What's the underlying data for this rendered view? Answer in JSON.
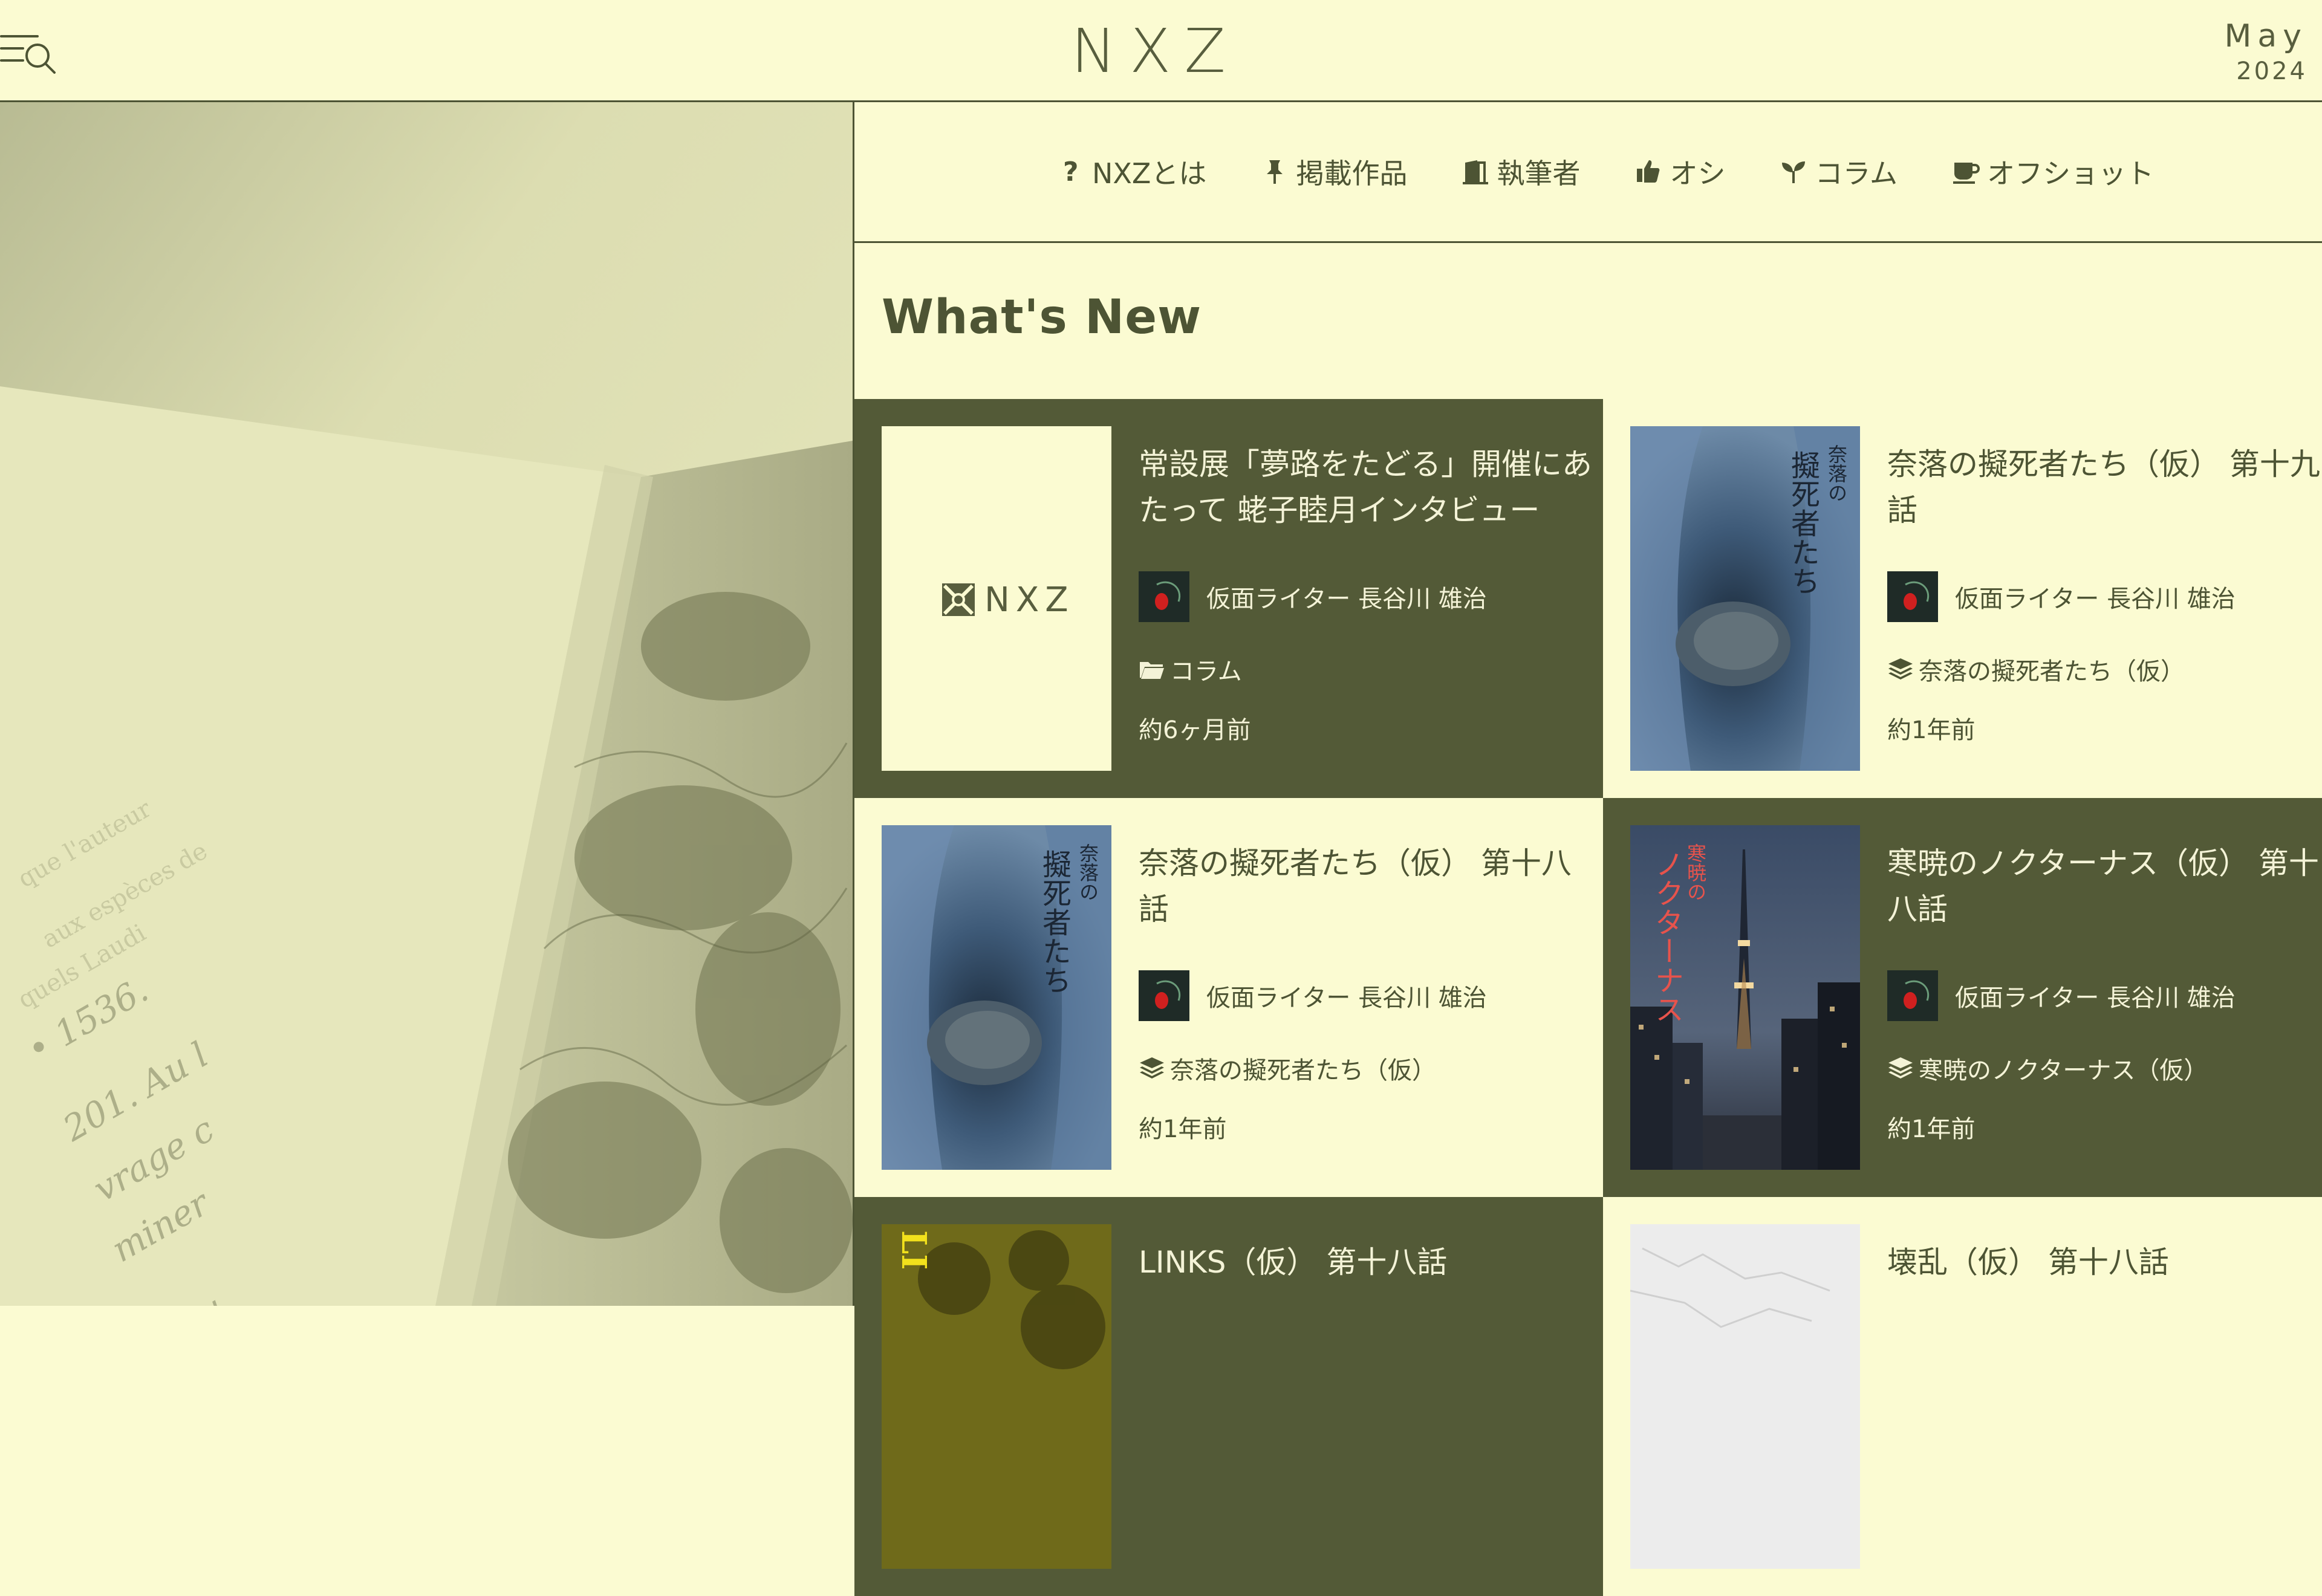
{
  "header": {
    "logo": "NXZ",
    "date_month": "May",
    "date_year": "2024"
  },
  "nav": {
    "items": [
      {
        "label": "NXZとは",
        "icon": "question-icon"
      },
      {
        "label": "掲載作品",
        "icon": "pin-icon"
      },
      {
        "label": "執筆者",
        "icon": "door-icon"
      },
      {
        "label": "オシ",
        "icon": "thumbs-up-icon"
      },
      {
        "label": "コラム",
        "icon": "seedling-icon"
      },
      {
        "label": "オフショット",
        "icon": "coffee-icon"
      }
    ]
  },
  "main": {
    "section_title": "What's New",
    "cards": [
      {
        "title": "常設展「夢路をたどる」開催にあたって 蛯子睦月インタビュー",
        "author": "仮面ライター 長谷川 雄治",
        "category": "コラム",
        "category_icon": "folder-icon",
        "time": "約6ヶ月前",
        "thumb": "nxz-logo",
        "thumb_text": "NXZ"
      },
      {
        "title": "奈落の擬死者たち（仮） 第十九話",
        "author": "仮面ライター 長谷川 雄治",
        "category": "奈落の擬死者たち（仮）",
        "category_icon": "layers-icon",
        "time": "約1年前",
        "thumb": "naraku-cover",
        "cover_small": "奈落の",
        "cover_big": "擬死者たち"
      },
      {
        "title": "奈落の擬死者たち（仮） 第十八話",
        "author": "仮面ライター 長谷川 雄治",
        "category": "奈落の擬死者たち（仮）",
        "category_icon": "layers-icon",
        "time": "約1年前",
        "thumb": "naraku-cover",
        "cover_small": "奈落の",
        "cover_big": "擬死者たち"
      },
      {
        "title": "寒暁のノクターナス（仮） 第十八話",
        "author": "仮面ライター 長谷川 雄治",
        "category": "寒暁のノクターナス（仮）",
        "category_icon": "layers-icon",
        "time": "約1年前",
        "thumb": "nocturnus-cover",
        "cover_small": "寒暁の",
        "cover_big": "ノクターナス"
      },
      {
        "title": "LINKS（仮） 第十八話",
        "thumb": "links-cover",
        "cover_text": "LI"
      },
      {
        "title": "壊乱（仮） 第十八話",
        "thumb": "marble-cover"
      }
    ]
  },
  "colors": {
    "background": "#fbfbd2",
    "dark_card": "#535a37",
    "text_dark": "#4d5434",
    "text_light": "#f4f3d7"
  }
}
